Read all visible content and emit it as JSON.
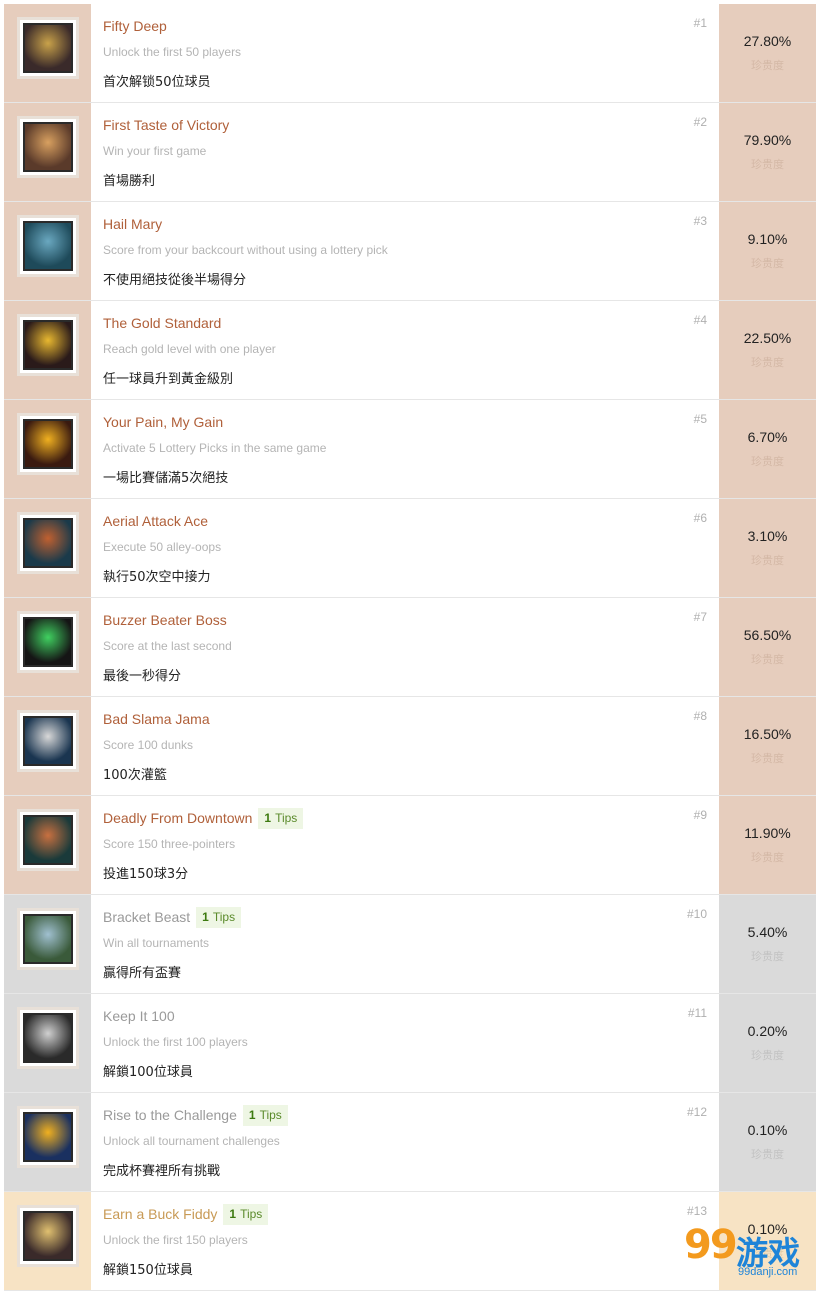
{
  "rarity_label": "珍贵度",
  "tips_count": "1",
  "tips_label": "Tips",
  "colors": {
    "orange_row": "#e6cdbd",
    "gray_row": "#dadada",
    "gold_row": "#f7e3c4",
    "title_orange": "#b0603a",
    "tips_green": "#5a8a2a"
  },
  "achievements": [
    {
      "number": "#1",
      "title": "Fifty Deep",
      "description": "Unlock the first 50 players",
      "chinese": "首次解锁50位球员",
      "percent": "27.80%",
      "tier": "orange",
      "icon": "players-50-icon",
      "has_tips": false
    },
    {
      "number": "#2",
      "title": "First Taste of Victory",
      "description": "Win your first game",
      "chinese": "首場勝利",
      "percent": "79.90%",
      "tier": "orange",
      "icon": "victory-player-icon",
      "has_tips": false
    },
    {
      "number": "#3",
      "title": "Hail Mary",
      "description": "Score from your backcourt without using a lottery pick",
      "chinese": "不使用絕技從後半場得分",
      "percent": "9.10%",
      "tier": "orange",
      "icon": "backcourt-shot-icon",
      "has_tips": false
    },
    {
      "number": "#4",
      "title": "The Gold Standard",
      "description": "Reach gold level with one player",
      "chinese": "任一球員升到黃金級別",
      "percent": "22.50%",
      "tier": "orange",
      "icon": "gold-ball-icon",
      "has_tips": false
    },
    {
      "number": "#5",
      "title": "Your Pain, My Gain",
      "description": "Activate 5 Lottery Picks in the same game",
      "chinese": "一場比賽儲滿5次絕技",
      "percent": "6.70%",
      "tier": "orange",
      "icon": "lottery-pick-icon",
      "has_tips": false
    },
    {
      "number": "#6",
      "title": "Aerial Attack Ace",
      "description": "Execute 50 alley-oops",
      "chinese": "執行50次空中接力",
      "percent": "3.10%",
      "tier": "orange",
      "icon": "alley-oop-icon",
      "has_tips": false
    },
    {
      "number": "#7",
      "title": "Buzzer Beater Boss",
      "description": "Score at the last second",
      "chinese": "最後一秒得分",
      "percent": "56.50%",
      "tier": "orange",
      "icon": "stopwatch-icon",
      "has_tips": false
    },
    {
      "number": "#8",
      "title": "Bad Slama Jama",
      "description": "Score 100 dunks",
      "chinese": "100次灌籃",
      "percent": "16.50%",
      "tier": "orange",
      "icon": "dunk-icon",
      "has_tips": false
    },
    {
      "number": "#9",
      "title": "Deadly From Downtown",
      "description": "Score 150 three-pointers",
      "chinese": "投進150球3分",
      "percent": "11.90%",
      "tier": "orange",
      "icon": "three-pointer-icon",
      "has_tips": true
    },
    {
      "number": "#10",
      "title": "Bracket Beast",
      "description": "Win all tournaments",
      "chinese": "贏得所有盃賽",
      "percent": "5.40%",
      "tier": "gray",
      "icon": "bracket-icon",
      "has_tips": true
    },
    {
      "number": "#11",
      "title": "Keep It 100",
      "description": "Unlock the first 100 players",
      "chinese": "解鎖100位球員",
      "percent": "0.20%",
      "tier": "gray",
      "icon": "players-100-icon",
      "has_tips": false
    },
    {
      "number": "#12",
      "title": "Rise to the Challenge",
      "description": "Unlock all tournament challenges",
      "chinese": "完成杯賽裡所有挑戰",
      "percent": "0.10%",
      "tier": "gray",
      "icon": "trophy-icon",
      "has_tips": true
    },
    {
      "number": "#13",
      "title": "Earn a Buck Fiddy",
      "description": "Unlock the first 150 players",
      "chinese": "解鎖150位球員",
      "percent": "0.10%",
      "tier": "gold",
      "icon": "players-150-icon",
      "has_tips": true
    }
  ],
  "watermark": {
    "logo": "99",
    "text": "游戏",
    "url": "99danji.com"
  }
}
